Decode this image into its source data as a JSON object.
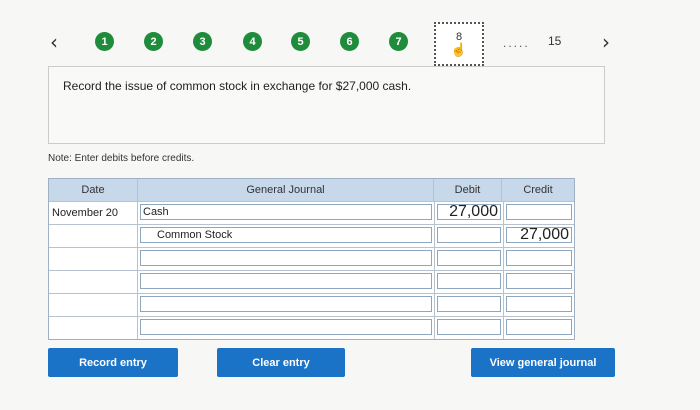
{
  "nav": {
    "prev_icon": "chevron-left-icon",
    "next_icon": "chevron-right-icon",
    "steps": [
      "1",
      "2",
      "3",
      "4",
      "5",
      "6",
      "7"
    ],
    "current_step": "8",
    "ellipsis": ".....",
    "last_step": "15"
  },
  "prompt": "Record the issue of common stock in exchange for $27,000 cash.",
  "note": "Note: Enter debits before credits.",
  "journal": {
    "headers": {
      "date": "Date",
      "account": "General Journal",
      "debit": "Debit",
      "credit": "Credit"
    },
    "rows": [
      {
        "date": "November 20",
        "account": "Cash",
        "debit": "27,000",
        "credit": ""
      },
      {
        "date": "",
        "account": "Common Stock",
        "debit": "",
        "credit": "27,000"
      },
      {
        "date": "",
        "account": "",
        "debit": "",
        "credit": ""
      },
      {
        "date": "",
        "account": "",
        "debit": "",
        "credit": ""
      },
      {
        "date": "",
        "account": "",
        "debit": "",
        "credit": ""
      },
      {
        "date": "",
        "account": "",
        "debit": "",
        "credit": ""
      }
    ]
  },
  "buttons": {
    "record": "Record entry",
    "clear": "Clear entry",
    "view": "View general journal"
  },
  "colors": {
    "step_done": "#1e8c3a",
    "button": "#1a73c7",
    "header": "#c7d8ea"
  }
}
